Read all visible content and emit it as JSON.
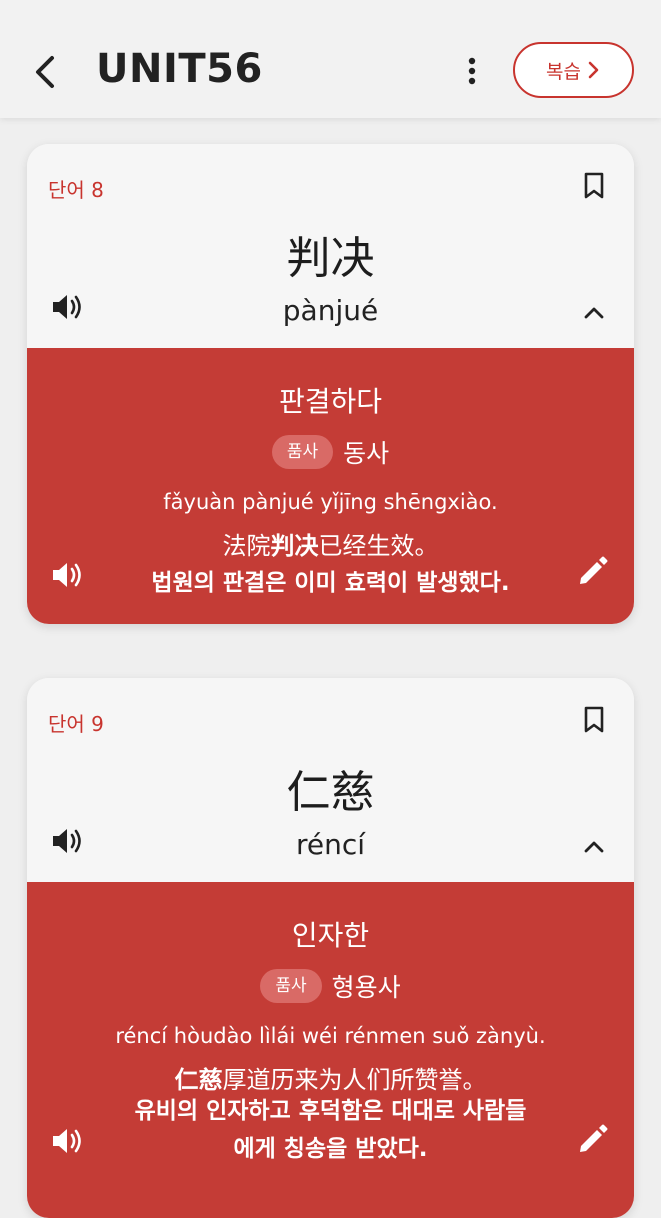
{
  "header": {
    "title": "UNIT56",
    "review_label": "복습"
  },
  "colors": {
    "accent": "#c8342e",
    "card_body": "#c43c36",
    "badge": "#d96a66",
    "background": "#efefef"
  },
  "cards": [
    {
      "index_label": "단어 8",
      "hanzi": "判决",
      "pinyin": "pànjué",
      "meaning": "판결하다",
      "pos_label": "품사",
      "pos": "동사",
      "example_pinyin": "fǎyuàn pànjué yǐjīng shēngxiào.",
      "example_pre": "法院",
      "example_word": "判决",
      "example_post": "已经生效。",
      "example_korean": "법원의 판결은 이미 효력이 발생했다."
    },
    {
      "index_label": "단어 9",
      "hanzi": "仁慈",
      "pinyin": "réncí",
      "meaning": "인자한",
      "pos_label": "품사",
      "pos": "형용사",
      "example_pinyin": "réncí hòudào lìlái wéi rénmen suǒ zànyù.",
      "example_pre": "",
      "example_word": "仁慈",
      "example_post": "厚道历来为人们所赞誉。",
      "example_korean_1": "유비의 인자하고 후덕함은 대대로 사람들",
      "example_korean_2": "에게 칭송을 받았다."
    }
  ],
  "icons": [
    "back-arrow-icon",
    "more-vertical-icon",
    "chevron-right-icon",
    "bookmark-icon",
    "speaker-icon",
    "chevron-up-icon",
    "pencil-icon"
  ]
}
